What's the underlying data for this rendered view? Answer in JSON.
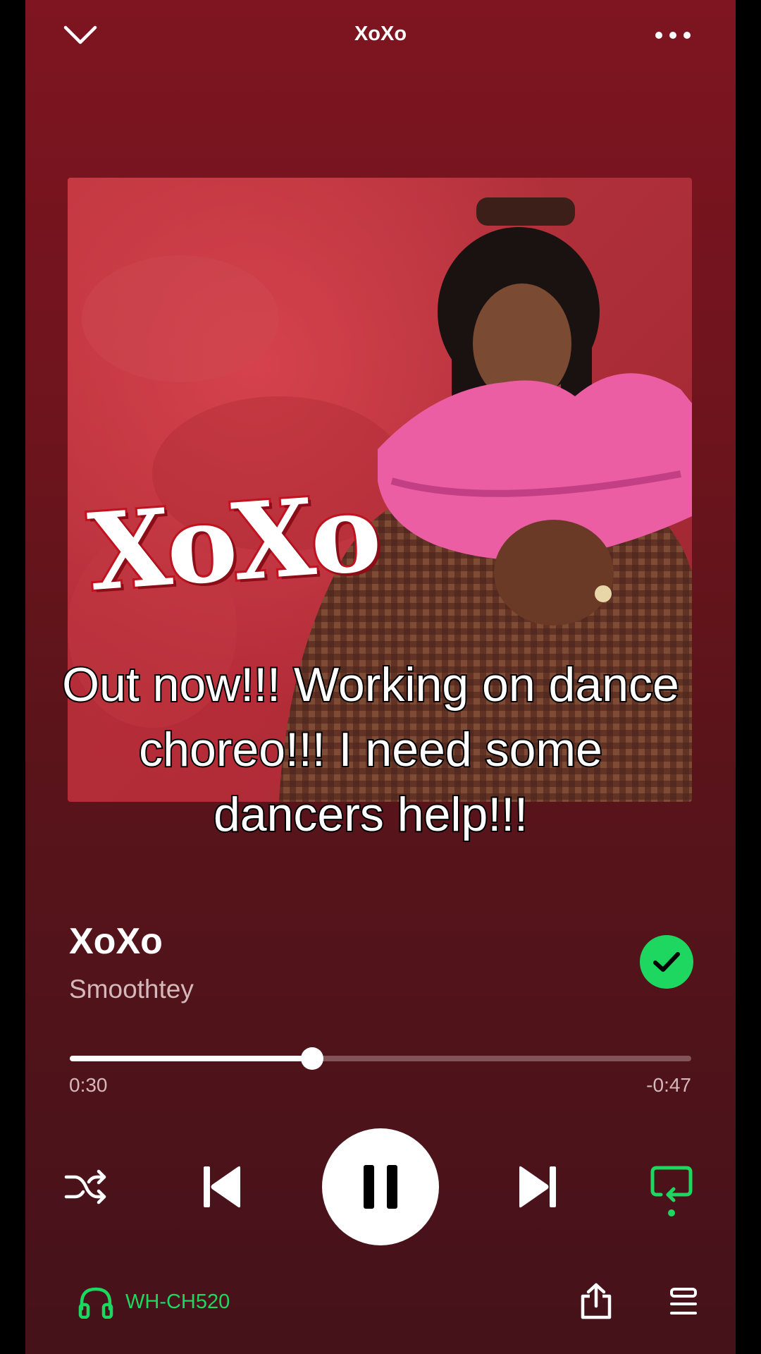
{
  "header": {
    "title": "XoXo",
    "collapse_icon": "chevron-down-icon",
    "more_icon": "more-horizontal-icon"
  },
  "artwork": {
    "logo_text": "XoXo",
    "caption": "Out now!!! Working on dance choreo!!! I need some dancers help!!!"
  },
  "track": {
    "title": "XoXo",
    "artist": "Smoothtey",
    "liked": true
  },
  "playback": {
    "elapsed": "0:30",
    "remaining": "-0:47",
    "progress_fraction": 0.39,
    "state": "playing"
  },
  "controls": {
    "shuffle_icon": "shuffle-icon",
    "previous_icon": "skip-previous-icon",
    "pause_icon": "pause-icon",
    "next_icon": "skip-next-icon",
    "repeat_icon": "repeat-icon"
  },
  "footer": {
    "device_name": "WH-CH520",
    "device_icon": "headphones-icon",
    "share_icon": "share-icon",
    "queue_icon": "queue-icon"
  },
  "colors": {
    "accent_green": "#1ed760",
    "background_top": "#7e1520",
    "background_bottom": "#45121a"
  }
}
